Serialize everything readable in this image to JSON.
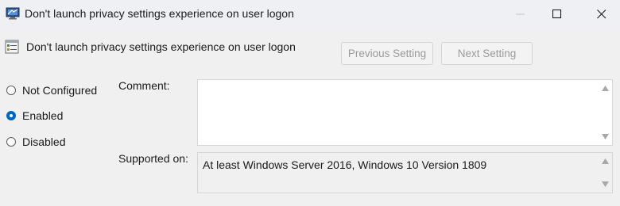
{
  "window": {
    "title": "Don't launch privacy settings experience on user logon"
  },
  "header": {
    "policy_name": "Don't launch privacy settings experience on user logon",
    "previous_label": "Previous Setting",
    "next_label": "Next Setting"
  },
  "state_options": [
    {
      "label": "Not Configured",
      "selected": false
    },
    {
      "label": "Enabled",
      "selected": true
    },
    {
      "label": "Disabled",
      "selected": false
    }
  ],
  "comment": {
    "label": "Comment:",
    "value": ""
  },
  "supported_on": {
    "label": "Supported on:",
    "value": "At least Windows Server 2016, Windows 10 Version 1809"
  },
  "colors": {
    "accent": "#0067c0",
    "titlebar": "#eef0f4",
    "background": "#f0f0f0"
  },
  "icons": [
    "policy-app-icon",
    "policy-setting-icon",
    "minimize-icon",
    "maximize-icon",
    "close-icon",
    "scroll-up-icon",
    "scroll-down-icon"
  ]
}
